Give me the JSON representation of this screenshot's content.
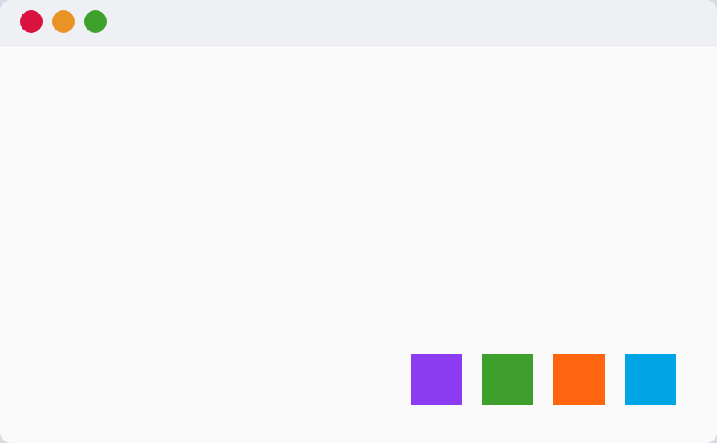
{
  "window": {
    "traffic_lights": [
      {
        "name": "close",
        "color": "#d9123f"
      },
      {
        "name": "minimize",
        "color": "#e89323"
      },
      {
        "name": "maximize",
        "color": "#3ea12c"
      }
    ]
  },
  "swatches": [
    {
      "name": "purple",
      "color": "#8b3bf0"
    },
    {
      "name": "green",
      "color": "#3f9f2c"
    },
    {
      "name": "orange",
      "color": "#ff650f"
    },
    {
      "name": "blue",
      "color": "#00a5e5"
    }
  ]
}
